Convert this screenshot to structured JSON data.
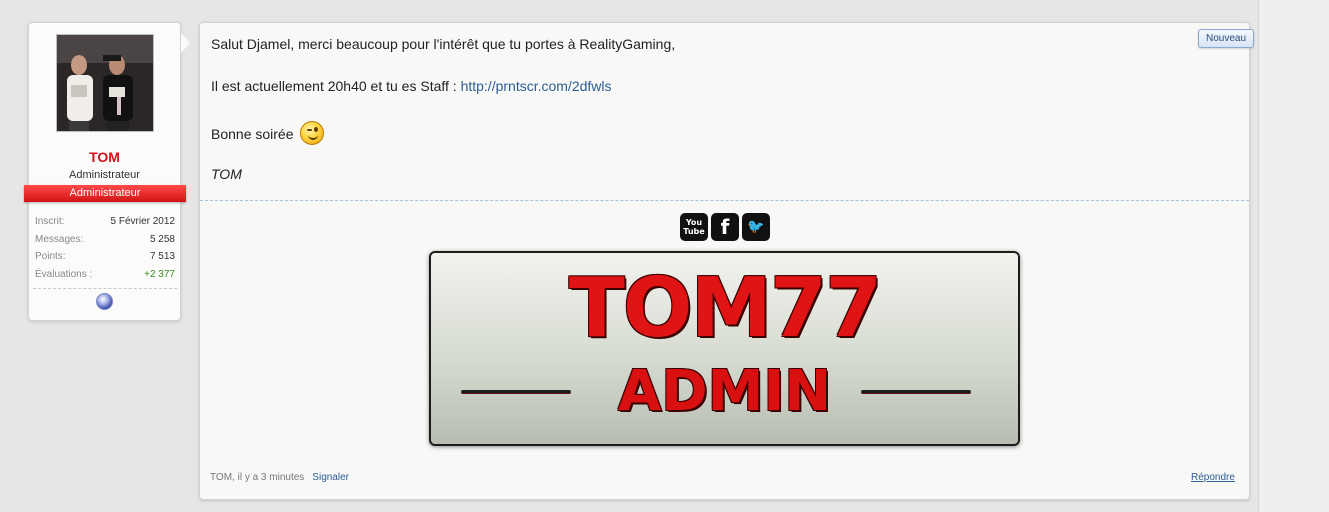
{
  "user": {
    "name": "TOM",
    "title": "Administrateur",
    "ribbon": "Administrateur",
    "stats": [
      {
        "label": "Inscrit:",
        "value": "5 Février 2012"
      },
      {
        "label": "Messages:",
        "value": "5 258"
      },
      {
        "label": "Points:",
        "value": "7 513"
      },
      {
        "label": "Évaluations :",
        "value": "+2 377"
      }
    ]
  },
  "post": {
    "badge": "Nouveau",
    "line1": "Salut Djamel, merci beaucoup pour l'intérêt que tu portes à RealityGaming,",
    "line2_text": "Il est actuellement 20h40 et tu es Staff : ",
    "line2_link": "http://prntscr.com/2dfwls",
    "line3": "Bonne soirée",
    "sign": "TOM",
    "social": {
      "youtube": "You Tube",
      "facebook": "f",
      "twitter": "🐦"
    },
    "banner": {
      "line1": "TOM77",
      "line2": "ADMIN"
    },
    "footer": {
      "meta": "TOM, il y a 3 minutes",
      "report": "Signaler",
      "reply": "Répondre"
    }
  },
  "colors": {
    "username": "#d0141a",
    "ribbon": "#e02020",
    "link": "#2c5d95",
    "positive": "#3d8b21"
  }
}
